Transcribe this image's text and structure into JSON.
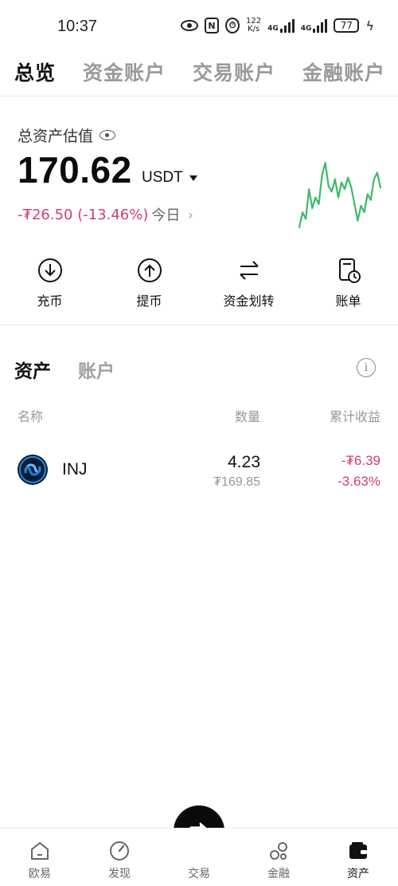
{
  "status_bar": {
    "time": "10:37",
    "speed_top": "122",
    "speed_bottom": "K/s",
    "net1": "4G",
    "net2": "4G",
    "battery": "77"
  },
  "top_tabs": [
    {
      "label": "总览",
      "active": true
    },
    {
      "label": "资金账户",
      "active": false
    },
    {
      "label": "交易账户",
      "active": false
    },
    {
      "label": "金融账户",
      "active": false
    }
  ],
  "overview": {
    "label": "总资产估值",
    "amount": "170.62",
    "unit": "USDT",
    "change": "-₮26.50 (-13.46%)",
    "period": "今日",
    "sparkline": [
      12,
      30,
      22,
      58,
      35,
      48,
      40,
      75,
      90,
      62,
      55,
      70,
      48,
      66,
      58,
      72,
      60,
      40,
      20,
      38,
      30,
      52,
      45,
      70,
      78,
      60
    ]
  },
  "actions": [
    {
      "label": "充币",
      "icon": "deposit-icon"
    },
    {
      "label": "提币",
      "icon": "withdraw-icon"
    },
    {
      "label": "资金划转",
      "icon": "transfer-icon"
    },
    {
      "label": "账单",
      "icon": "bill-icon"
    }
  ],
  "section_tabs": [
    {
      "label": "资产",
      "active": true
    },
    {
      "label": "账户",
      "active": false
    }
  ],
  "table": {
    "headers": {
      "name": "名称",
      "quantity": "数量",
      "pnl": "累计收益"
    },
    "rows": [
      {
        "name": "INJ",
        "quantity": "4.23",
        "value": "₮169.85",
        "pnl": "-₮6.39",
        "pnl_pct": "-3.63%"
      }
    ]
  },
  "bottom_nav": [
    {
      "label": "欧易",
      "icon": "home-icon",
      "active": false
    },
    {
      "label": "发现",
      "icon": "discover-icon",
      "active": false
    },
    {
      "label": "交易",
      "icon": "trade-icon",
      "active": false
    },
    {
      "label": "金融",
      "icon": "finance-icon",
      "active": false
    },
    {
      "label": "资产",
      "icon": "wallet-icon",
      "active": true
    }
  ],
  "colors": {
    "negative": "#d23f6b",
    "sparkline": "#3dba6a"
  }
}
